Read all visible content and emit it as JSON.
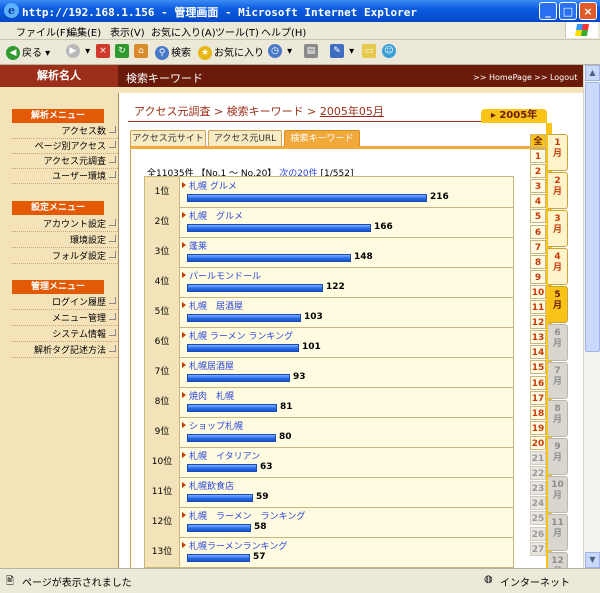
{
  "window": {
    "title": "http://192.168.1.156 - 管理画面 - Microsoft Internet Explorer"
  },
  "menu": [
    "ファイル(F)",
    "編集(E)",
    "表示(V)",
    "お気に入り(A)",
    "ツール(T)",
    "ヘルプ(H)"
  ],
  "toolbar": {
    "back": "戻る",
    "search": "検索",
    "favorites": "お気に入り"
  },
  "brand": "解析名人",
  "header": {
    "title": "検索キーワード",
    "home": ">> HomePage",
    "logout": ">> Logout"
  },
  "sidebar": {
    "analysis_title": "解析メニュー",
    "analysis_items": [
      "アクセス数",
      "ページ別アクセス",
      "アクセス元調査",
      "ユーザー環境"
    ],
    "settings_title": "設定メニュー",
    "settings_items": [
      "アカウント設定",
      "環境設定",
      "フォルダ設定"
    ],
    "admin_title": "管理メニュー",
    "admin_items": [
      "ログイン履歴",
      "メニュー管理",
      "システム情報",
      "解析タグ記述方法"
    ]
  },
  "breadcrumb": {
    "part1": "アクセス元調査",
    "sep": ">",
    "part2": "検索キーワード",
    "part3": "2005年05月"
  },
  "tabs": [
    "アクセス元サイト",
    "アクセス元URL",
    "検索キーワード"
  ],
  "summary": {
    "total": "全11035件",
    "range": "【No.1 〜 No.20】",
    "next": "次の20件",
    "page": "[1/552]"
  },
  "ranking": [
    {
      "rank": "1位",
      "keyword": "札幌 グルメ",
      "count": 216
    },
    {
      "rank": "2位",
      "keyword": "札幌　グルメ",
      "count": 166
    },
    {
      "rank": "3位",
      "keyword": "蓬莱",
      "count": 148
    },
    {
      "rank": "4位",
      "keyword": "パールモンドール",
      "count": 122
    },
    {
      "rank": "5位",
      "keyword": "札幌　居酒屋",
      "count": 103
    },
    {
      "rank": "6位",
      "keyword": "札幌 ラーメン ランキング",
      "count": 101
    },
    {
      "rank": "7位",
      "keyword": "札幌居酒屋",
      "count": 93
    },
    {
      "rank": "8位",
      "keyword": "焼肉　札幌",
      "count": 81
    },
    {
      "rank": "9位",
      "keyword": "ショップ札幌",
      "count": 80
    },
    {
      "rank": "10位",
      "keyword": "札幌　イタリアン",
      "count": 63
    },
    {
      "rank": "11位",
      "keyword": "札幌飲食店",
      "count": 59
    },
    {
      "rank": "12位",
      "keyword": "札幌　ラーメン　ランキング",
      "count": 58
    },
    {
      "rank": "13位",
      "keyword": "札幌ラーメンランキング",
      "count": 57
    }
  ],
  "year_tab": "2005年",
  "days": {
    "all": "全",
    "list": [
      "1",
      "2",
      "3",
      "4",
      "5",
      "6",
      "7",
      "8",
      "9",
      "10",
      "11",
      "12",
      "13",
      "14",
      "15",
      "16",
      "17",
      "18",
      "19",
      "20",
      "21",
      "22",
      "23",
      "24",
      "25",
      "26",
      "27"
    ],
    "active_through": 20
  },
  "months": {
    "list": [
      "1月",
      "2月",
      "3月",
      "4月",
      "5月",
      "6月",
      "7月",
      "8月",
      "9月",
      "10月",
      "11月",
      "12月"
    ],
    "selected": 5
  },
  "status": {
    "left": "ページが表示されました",
    "zone": "インターネット"
  },
  "colors": {
    "brand": "#9c2f19",
    "header": "#6b1b0a",
    "menu_head": "#e25a05",
    "bar": "#2167e8",
    "link": "#2b47d9"
  }
}
